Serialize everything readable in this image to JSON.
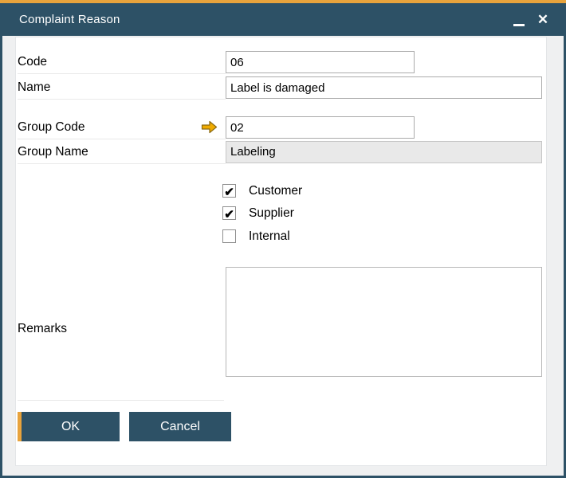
{
  "titlebar": {
    "title": "Complaint Reason"
  },
  "icons": {
    "minimize": "minimize-icon",
    "close_glyph": "✕",
    "checkmark_glyph": "✔",
    "link_arrow": "link-arrow-icon"
  },
  "fields": {
    "code": {
      "label": "Code",
      "value": "06"
    },
    "name": {
      "label": "Name",
      "value": "Label is damaged"
    },
    "group_code": {
      "label": "Group Code",
      "value": "02"
    },
    "group_name": {
      "label": "Group Name",
      "value": "Labeling"
    },
    "remarks": {
      "label": "Remarks",
      "value": ""
    }
  },
  "checkboxes": [
    {
      "label": "Customer",
      "checked": true
    },
    {
      "label": "Supplier",
      "checked": true
    },
    {
      "label": "Internal",
      "checked": false
    }
  ],
  "buttons": {
    "ok": "OK",
    "cancel": "Cancel"
  },
  "colors": {
    "accent_gold": "#E8A33C",
    "chrome_blue": "#2D5166",
    "readonly_bg": "#E9E9E9"
  }
}
